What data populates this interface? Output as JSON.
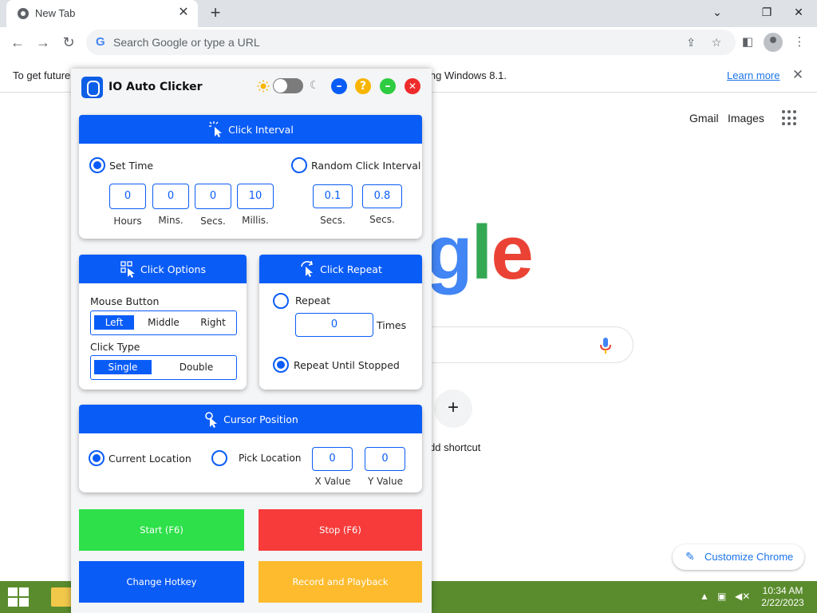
{
  "browser": {
    "tab_title": "New Tab",
    "tab_close": "✕",
    "new_tab": "+",
    "window": {
      "minimize": "⌄",
      "restore": "❐",
      "close": "✕"
    },
    "nav": {
      "back": "←",
      "forward": "→",
      "reload": "↻"
    },
    "omnibox": {
      "g": "G",
      "placeholder": "Search Google or type a URL"
    },
    "toolbar_icons": {
      "share": "⇪",
      "bookmark": "☆",
      "side_panel": "◧",
      "menu": "⋮"
    }
  },
  "infobar": {
    "text_left": "To get future",
    "text_right": "ing Windows 8.1.",
    "learn_more": "Learn more",
    "close": "✕"
  },
  "ntp": {
    "gmail": "Gmail",
    "images": "Images",
    "logo": [
      {
        "ch": "g",
        "color": "#4285f4"
      },
      {
        "ch": "l",
        "color": "#34a853"
      },
      {
        "ch": "e",
        "color": "#ea4335"
      }
    ],
    "shortcut_plus": "+",
    "shortcut_label": "dd shortcut",
    "customize_icon": "✎",
    "customize_label": "Customize Chrome"
  },
  "taskbar": {
    "tray_up": "▲",
    "tray_network": "▣",
    "tray_volume": "◀✕",
    "time": "10:34 AM",
    "date": "2/22/2023"
  },
  "app": {
    "title": "IO Auto Clicker",
    "moon": "☾",
    "btn_minimize": "–",
    "btn_help": "?",
    "btn_maximize": "–",
    "btn_close": "✕",
    "colors": {
      "accent": "#0a5cf7",
      "help": "#f7b500",
      "maximize": "#2ecc40",
      "close": "#ee2b2b",
      "start": "#2ee04a",
      "stop": "#f73b3b",
      "hotkey": "#0a5cf7",
      "record": "#fdbb2d"
    },
    "interval": {
      "header": "Click Interval",
      "set_time_label": "Set Time",
      "random_label": "Random Click Interval",
      "hours_value": "0",
      "hours_label": "Hours",
      "mins_value": "0",
      "mins_label": "Mins.",
      "secs_value": "0",
      "secs_label": "Secs.",
      "millis_value": "10",
      "millis_label": "Millis.",
      "random_min_value": "0.1",
      "random_min_label": "Secs.",
      "random_max_value": "0.8",
      "random_max_label": "Secs."
    },
    "options": {
      "header": "Click Options",
      "mouse_button_label": "Mouse Button",
      "mouse_buttons": [
        "Left",
        "Middle",
        "Right"
      ],
      "click_type_label": "Click Type",
      "click_types": [
        "Single",
        "Double"
      ]
    },
    "repeat": {
      "header": "Click Repeat",
      "repeat_label": "Repeat",
      "repeat_value": "0",
      "times_label": "Times",
      "until_stopped_label": "Repeat Until Stopped"
    },
    "cursor": {
      "header": "Cursor Position",
      "current_label": "Current Location",
      "pick_label": "Pick Location",
      "x_value": "0",
      "x_label": "X Value",
      "y_value": "0",
      "y_label": "Y Value"
    },
    "buttons": {
      "start": "Start (F6)",
      "stop": "Stop (F6)",
      "hotkey": "Change Hotkey",
      "record": "Record and Playback"
    }
  }
}
